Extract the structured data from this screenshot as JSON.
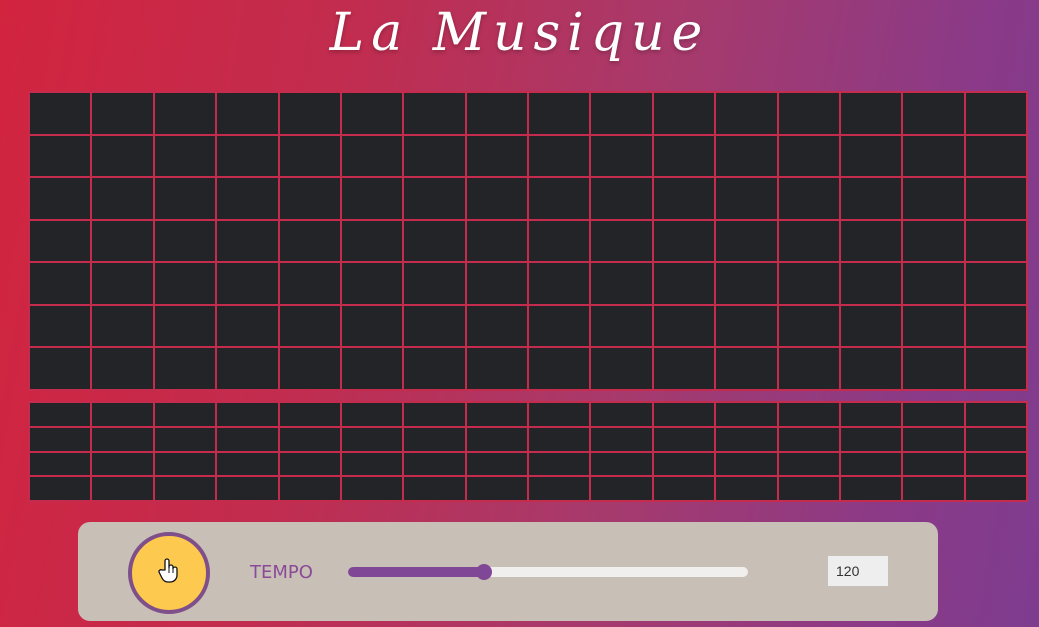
{
  "title": "La Musique",
  "grid_top": {
    "rows": 7,
    "cols": 16,
    "line_color": "#c42b4c",
    "cell_color": "#222428"
  },
  "grid_bottom": {
    "rows": 4,
    "cols": 16,
    "line_color": "#c42b4c",
    "cell_color": "#222428"
  },
  "controls": {
    "tempo_label": "TEMPO",
    "tempo_value": "120",
    "tempo_slider_fraction": 0.34,
    "play_icon": "hand-pointer-icon"
  },
  "colors": {
    "accent_purple": "#7f4795",
    "play_yellow": "#fdc94e",
    "panel_beige": "#c8bfb6"
  }
}
